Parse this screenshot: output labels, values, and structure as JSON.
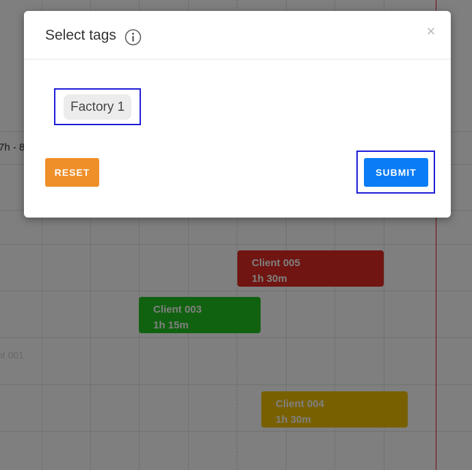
{
  "modal": {
    "title": "Select tags",
    "close_label": "×",
    "tags": [
      "Factory 1"
    ],
    "reset_label": "RESET",
    "submit_label": "SUBMIT"
  },
  "schedule": {
    "time_label": "7h - 8",
    "faded_label": "nt 001",
    "events": [
      {
        "client": "Client 005",
        "duration": "1h 30m",
        "color": "#e02a22"
      },
      {
        "client": "Client 003",
        "duration": "1h 15m",
        "color": "#22c420"
      },
      {
        "client": "Client 004",
        "duration": "1h 30m",
        "color": "#f0c000"
      }
    ]
  },
  "colors": {
    "overlay": "rgba(0,0,0,0.5)",
    "reset": "#ef8f2a",
    "submit": "#0a7cf5",
    "highlight": "#1a1ad8",
    "now_line": "#e02020"
  }
}
